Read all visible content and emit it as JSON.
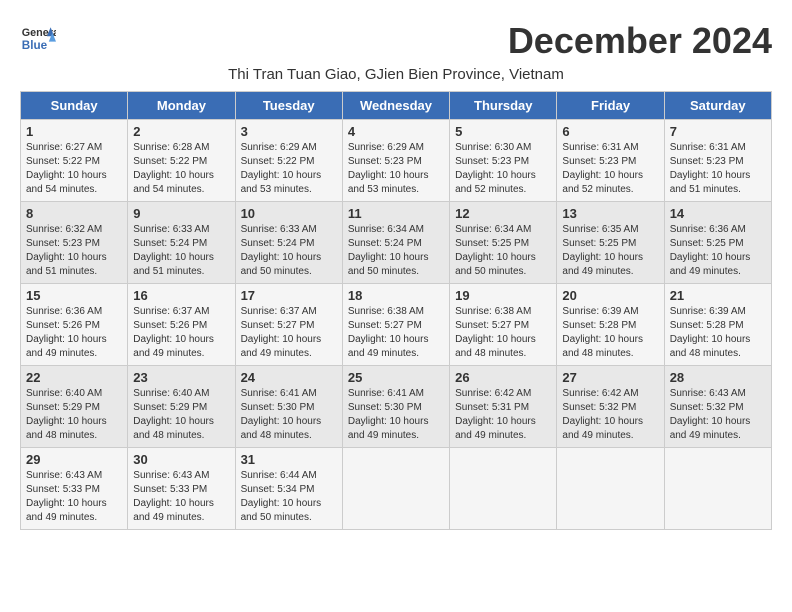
{
  "header": {
    "logo_line1": "General",
    "logo_line2": "Blue",
    "month_title": "December 2024",
    "location": "Thi Tran Tuan Giao, GJien Bien Province, Vietnam"
  },
  "days_of_week": [
    "Sunday",
    "Monday",
    "Tuesday",
    "Wednesday",
    "Thursday",
    "Friday",
    "Saturday"
  ],
  "weeks": [
    [
      {
        "day": 1,
        "sunrise": "6:27 AM",
        "sunset": "5:22 PM",
        "daylight": "10 hours and 54 minutes."
      },
      {
        "day": 2,
        "sunrise": "6:28 AM",
        "sunset": "5:22 PM",
        "daylight": "10 hours and 54 minutes."
      },
      {
        "day": 3,
        "sunrise": "6:29 AM",
        "sunset": "5:22 PM",
        "daylight": "10 hours and 53 minutes."
      },
      {
        "day": 4,
        "sunrise": "6:29 AM",
        "sunset": "5:23 PM",
        "daylight": "10 hours and 53 minutes."
      },
      {
        "day": 5,
        "sunrise": "6:30 AM",
        "sunset": "5:23 PM",
        "daylight": "10 hours and 52 minutes."
      },
      {
        "day": 6,
        "sunrise": "6:31 AM",
        "sunset": "5:23 PM",
        "daylight": "10 hours and 52 minutes."
      },
      {
        "day": 7,
        "sunrise": "6:31 AM",
        "sunset": "5:23 PM",
        "daylight": "10 hours and 51 minutes."
      }
    ],
    [
      {
        "day": 8,
        "sunrise": "6:32 AM",
        "sunset": "5:23 PM",
        "daylight": "10 hours and 51 minutes."
      },
      {
        "day": 9,
        "sunrise": "6:33 AM",
        "sunset": "5:24 PM",
        "daylight": "10 hours and 51 minutes."
      },
      {
        "day": 10,
        "sunrise": "6:33 AM",
        "sunset": "5:24 PM",
        "daylight": "10 hours and 50 minutes."
      },
      {
        "day": 11,
        "sunrise": "6:34 AM",
        "sunset": "5:24 PM",
        "daylight": "10 hours and 50 minutes."
      },
      {
        "day": 12,
        "sunrise": "6:34 AM",
        "sunset": "5:25 PM",
        "daylight": "10 hours and 50 minutes."
      },
      {
        "day": 13,
        "sunrise": "6:35 AM",
        "sunset": "5:25 PM",
        "daylight": "10 hours and 49 minutes."
      },
      {
        "day": 14,
        "sunrise": "6:36 AM",
        "sunset": "5:25 PM",
        "daylight": "10 hours and 49 minutes."
      }
    ],
    [
      {
        "day": 15,
        "sunrise": "6:36 AM",
        "sunset": "5:26 PM",
        "daylight": "10 hours and 49 minutes."
      },
      {
        "day": 16,
        "sunrise": "6:37 AM",
        "sunset": "5:26 PM",
        "daylight": "10 hours and 49 minutes."
      },
      {
        "day": 17,
        "sunrise": "6:37 AM",
        "sunset": "5:27 PM",
        "daylight": "10 hours and 49 minutes."
      },
      {
        "day": 18,
        "sunrise": "6:38 AM",
        "sunset": "5:27 PM",
        "daylight": "10 hours and 49 minutes."
      },
      {
        "day": 19,
        "sunrise": "6:38 AM",
        "sunset": "5:27 PM",
        "daylight": "10 hours and 48 minutes."
      },
      {
        "day": 20,
        "sunrise": "6:39 AM",
        "sunset": "5:28 PM",
        "daylight": "10 hours and 48 minutes."
      },
      {
        "day": 21,
        "sunrise": "6:39 AM",
        "sunset": "5:28 PM",
        "daylight": "10 hours and 48 minutes."
      }
    ],
    [
      {
        "day": 22,
        "sunrise": "6:40 AM",
        "sunset": "5:29 PM",
        "daylight": "10 hours and 48 minutes."
      },
      {
        "day": 23,
        "sunrise": "6:40 AM",
        "sunset": "5:29 PM",
        "daylight": "10 hours and 48 minutes."
      },
      {
        "day": 24,
        "sunrise": "6:41 AM",
        "sunset": "5:30 PM",
        "daylight": "10 hours and 48 minutes."
      },
      {
        "day": 25,
        "sunrise": "6:41 AM",
        "sunset": "5:30 PM",
        "daylight": "10 hours and 49 minutes."
      },
      {
        "day": 26,
        "sunrise": "6:42 AM",
        "sunset": "5:31 PM",
        "daylight": "10 hours and 49 minutes."
      },
      {
        "day": 27,
        "sunrise": "6:42 AM",
        "sunset": "5:32 PM",
        "daylight": "10 hours and 49 minutes."
      },
      {
        "day": 28,
        "sunrise": "6:43 AM",
        "sunset": "5:32 PM",
        "daylight": "10 hours and 49 minutes."
      }
    ],
    [
      {
        "day": 29,
        "sunrise": "6:43 AM",
        "sunset": "5:33 PM",
        "daylight": "10 hours and 49 minutes."
      },
      {
        "day": 30,
        "sunrise": "6:43 AM",
        "sunset": "5:33 PM",
        "daylight": "10 hours and 49 minutes."
      },
      {
        "day": 31,
        "sunrise": "6:44 AM",
        "sunset": "5:34 PM",
        "daylight": "10 hours and 50 minutes."
      },
      null,
      null,
      null,
      null
    ]
  ]
}
